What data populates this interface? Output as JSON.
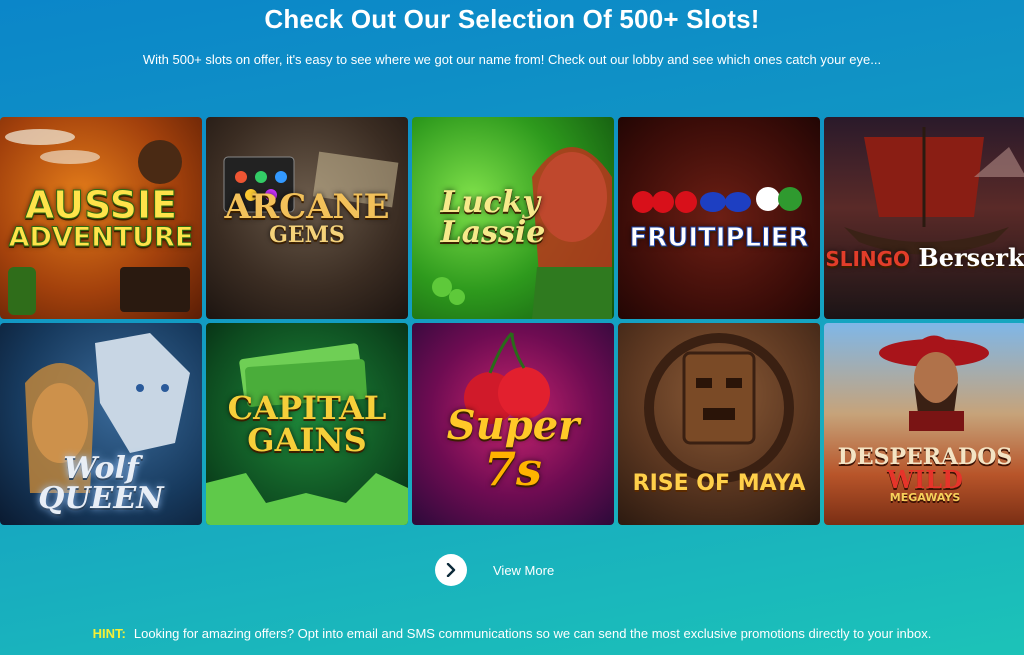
{
  "heading": "Check Out Our Selection Of 500+ Slots!",
  "subheading": "With 500+ slots on offer, it's easy to see where we got our name from! Check out our lobby and see which ones catch your eye...",
  "games": [
    {
      "line1": "AUSSIE",
      "line2": "ADVENTURE"
    },
    {
      "line1": "ARCANE",
      "line2": "GEMS"
    },
    {
      "line1": "Lucky",
      "line2": "Lassie"
    },
    {
      "line1": "FRUITIPLIER",
      "line2": ""
    },
    {
      "line1": "SLINGO",
      "line2": "Berserk"
    },
    {
      "line1": "Wolf",
      "line2": "QUEEN"
    },
    {
      "line1": "CAPITAL",
      "line2": "GAINS"
    },
    {
      "line1": "Super",
      "line2": "7s"
    },
    {
      "line1": "RISE OF MAYA",
      "line2": ""
    },
    {
      "line1": "DESPERADOS",
      "line2": "WILD",
      "line3": "MEGAWAYS"
    }
  ],
  "view_more": {
    "label": "View More",
    "icon": "chevron-right-icon"
  },
  "hint": {
    "label": "HINT:",
    "text": "Looking for amazing offers? Opt into email and SMS communications so we can send the most exclusive promotions directly to your inbox."
  },
  "colors": {
    "accent_hint": "#f5ef36",
    "bg_start": "#0b86c9",
    "bg_end": "#1cc3b8"
  }
}
